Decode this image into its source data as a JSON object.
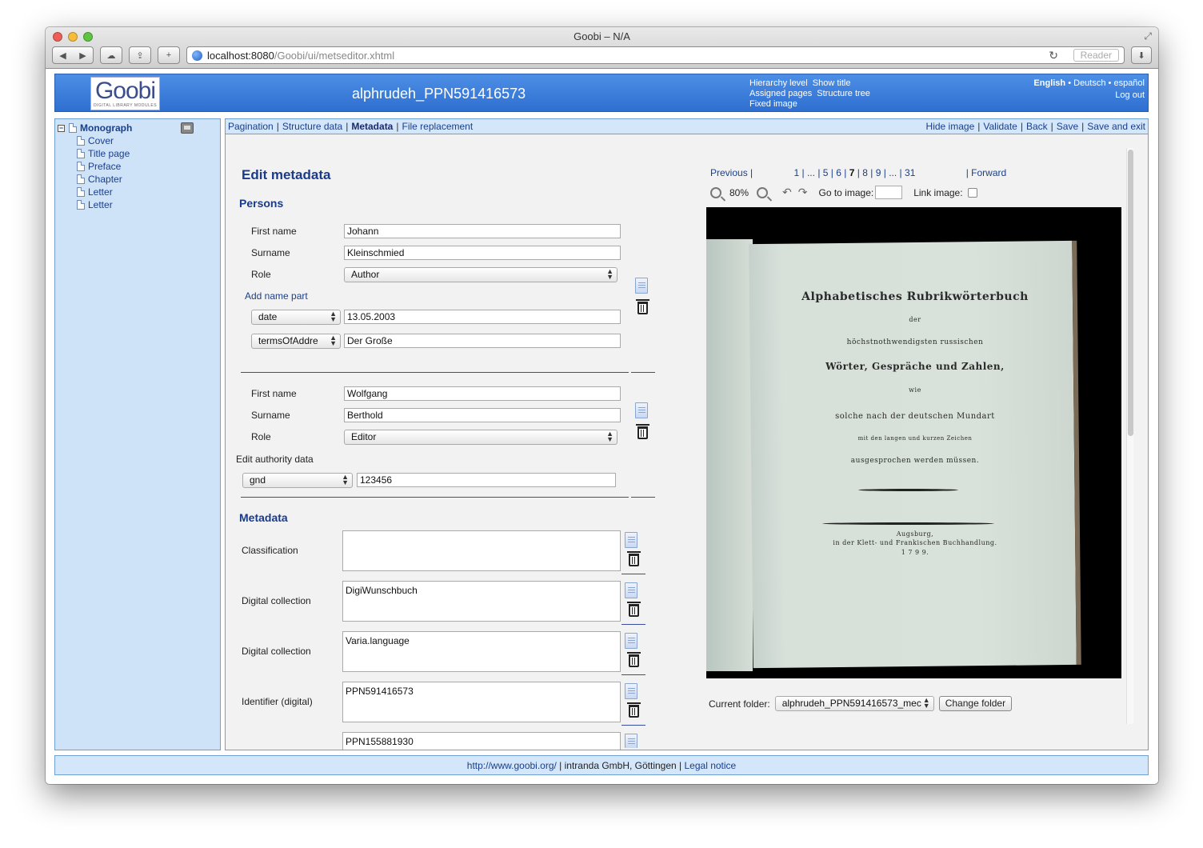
{
  "window": {
    "title": "Goobi – N/A",
    "url_host": "localhost:8080",
    "url_path": "/Goobi/ui/metseditor.xhtml",
    "reader_label": "Reader"
  },
  "header": {
    "logo_text": "Goobi",
    "logo_sub": "DIGITAL LIBRARY MODULES",
    "process_title": "alphrudeh_PPN591416573",
    "links": {
      "hierarchy_level": "Hierarchy level",
      "show_title": "Show title",
      "assigned_pages": "Assigned pages",
      "structure_tree": "Structure tree",
      "fixed_image": "Fixed image"
    },
    "languages": {
      "english": "English",
      "deutsch": "Deutsch",
      "espanol": "español",
      "sep": " • "
    },
    "logout": "Log out"
  },
  "tree": {
    "root": "Monograph",
    "children": [
      "Cover",
      "Title page",
      "Preface",
      "Chapter",
      "Letter",
      "Letter"
    ]
  },
  "tabs": {
    "left": [
      "Pagination",
      "Structure data",
      "Metadata",
      "File replacement"
    ],
    "active": "Metadata",
    "right": [
      "Hide image",
      "Validate",
      "Back",
      "Save",
      "Save and exit"
    ],
    "sep": "|"
  },
  "edit": {
    "title": "Edit metadata",
    "persons_title": "Persons",
    "metadata_title": "Metadata",
    "person1": {
      "first_name_label": "First name",
      "first_name": "Johann",
      "surname_label": "Surname",
      "surname": "Kleinschmied",
      "role_label": "Role",
      "role": "Author",
      "add_name_part": "Add name part",
      "part1_type": "date",
      "part1_value": "13.05.2003",
      "part2_type": "termsOfAddre",
      "part2_value": "Der Große"
    },
    "person2": {
      "first_name_label": "First name",
      "first_name": "Wolfgang",
      "surname_label": "Surname",
      "surname": "Berthold",
      "role_label": "Role",
      "role": "Editor",
      "authority_label": "Edit authority data",
      "authority_type": "gnd",
      "authority_value": "123456"
    },
    "metadata": [
      {
        "label": "Classification",
        "value": ""
      },
      {
        "label": "Digital collection",
        "value": "DigiWunschbuch"
      },
      {
        "label": "Digital collection",
        "value": "Varia.language"
      },
      {
        "label": "Identifier (digital)",
        "value": "PPN591416573"
      },
      {
        "label": "",
        "value": "PPN155881930"
      }
    ]
  },
  "viewer": {
    "previous": "Previous",
    "pages": [
      "1",
      "...",
      "5",
      "6",
      "7",
      "8",
      "9",
      "...",
      "31"
    ],
    "current_page": "7",
    "forward": "Forward",
    "zoom_level": "80%",
    "go_to_image_label": "Go to image:",
    "link_image_label": "Link image:",
    "scan_lines": [
      "Alphabetisches Rubrikwörterbuch",
      "der",
      "höchstnothwendigsten russischen",
      "Wörter, Gespräche und Zahlen,",
      "wie",
      "solche nach der deutschen Mundart",
      "mit den langen und kurzen Zeichen",
      "ausgesprochen werden müssen.",
      "Augsburg,",
      "in der Klett- und Frankischen Buchhandlung.",
      "1 7 9 9."
    ],
    "current_folder_label": "Current folder:",
    "current_folder": "alphrudeh_PPN591416573_mec",
    "change_folder": "Change folder"
  },
  "footer": {
    "link": "http://www.goobi.org/",
    "company": " | intranda GmbH, Göttingen | ",
    "legal": "Legal notice"
  }
}
